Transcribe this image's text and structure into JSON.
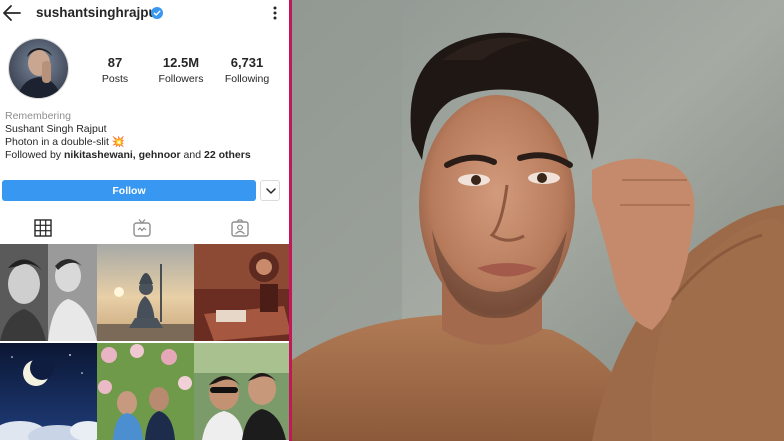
{
  "profile": {
    "username": "sushantsinghrajput",
    "verified": true,
    "stats": {
      "posts": {
        "value": "87",
        "label": "Posts"
      },
      "followers": {
        "value": "12.5M",
        "label": "Followers"
      },
      "following": {
        "value": "6,731",
        "label": "Following"
      }
    },
    "bio": {
      "status": "Remembering",
      "full_name": "Sushant Singh Rajput",
      "text": "Photon in a double-slit",
      "text_emoji": "💥",
      "followed_prefix": "Followed by ",
      "followed_names": "nikitashewani, gehnoor",
      "followed_mid": " and ",
      "followed_count": "22 others"
    },
    "follow_label": "Follow",
    "tabs": [
      "grid-icon",
      "igtv-icon",
      "tagged-icon"
    ],
    "colors": {
      "follow_button": "#3897f0",
      "verified": "#3897f0",
      "divider": "#c2185b"
    }
  }
}
